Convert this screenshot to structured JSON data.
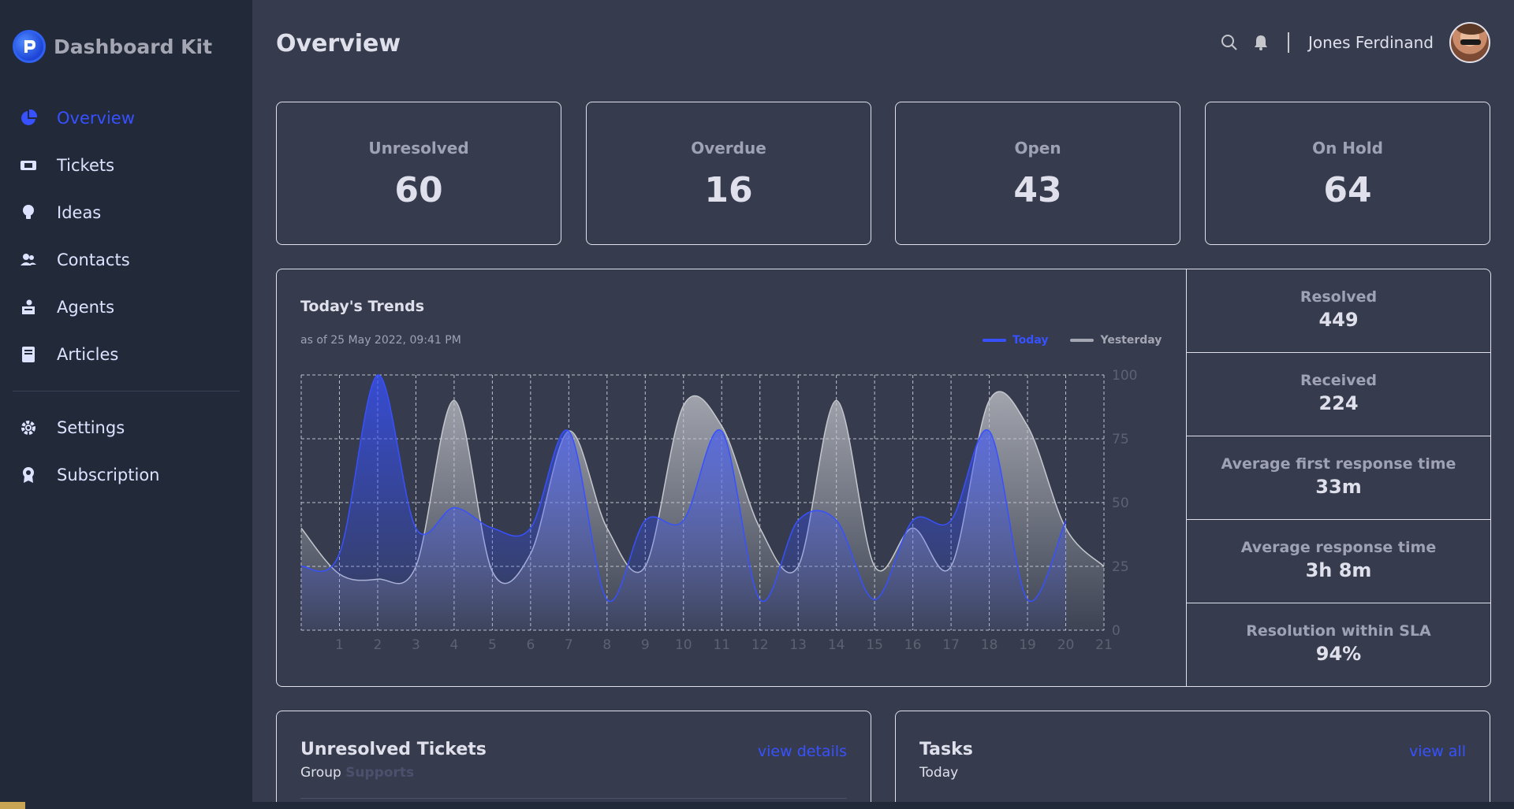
{
  "brand": {
    "name": "Dashboard Kit"
  },
  "nav": {
    "items": [
      {
        "label": "Overview",
        "icon": "pie-chart-icon",
        "active": true
      },
      {
        "label": "Tickets",
        "icon": "ticket-icon",
        "active": false
      },
      {
        "label": "Ideas",
        "icon": "lightbulb-icon",
        "active": false
      },
      {
        "label": "Contacts",
        "icon": "users-icon",
        "active": false
      },
      {
        "label": "Agents",
        "icon": "agent-icon",
        "active": false
      },
      {
        "label": "Articles",
        "icon": "book-icon",
        "active": false
      }
    ],
    "bottom_items": [
      {
        "label": "Settings",
        "icon": "gear-icon"
      },
      {
        "label": "Subscription",
        "icon": "award-icon"
      }
    ]
  },
  "header": {
    "title": "Overview",
    "user_name": "Jones Ferdinand",
    "icons": [
      "search-icon",
      "bell-icon"
    ]
  },
  "stats": [
    {
      "label": "Unresolved",
      "value": "60"
    },
    {
      "label": "Overdue",
      "value": "16"
    },
    {
      "label": "Open",
      "value": "43"
    },
    {
      "label": "On Hold",
      "value": "64"
    }
  ],
  "trends": {
    "title": "Today's Trends",
    "subtitle": "as of 25 May 2022, 09:41 PM",
    "legend": {
      "today": "Today",
      "yesterday": "Yesterday"
    },
    "colors": {
      "today": "#3751ff",
      "yesterday": "#a4a6b3"
    }
  },
  "chart_data": {
    "type": "area",
    "x": [
      0,
      1,
      2,
      3,
      4,
      5,
      6,
      7,
      8,
      9,
      10,
      11,
      12,
      13,
      14,
      15,
      16,
      17,
      18,
      19,
      20,
      21
    ],
    "x_tick_labels": [
      "1",
      "2",
      "3",
      "4",
      "5",
      "6",
      "7",
      "8",
      "9",
      "10",
      "11",
      "12",
      "13",
      "14",
      "15",
      "16",
      "17",
      "18",
      "19",
      "20",
      "21"
    ],
    "ylim": [
      0,
      100
    ],
    "y_ticks": [
      0,
      25,
      50,
      75,
      100
    ],
    "grid": true,
    "series": [
      {
        "name": "Today",
        "values": [
          25,
          30,
          100,
          40,
          48,
          40,
          40,
          78,
          12,
          43,
          43,
          78,
          12,
          43,
          43,
          12,
          43,
          43,
          78,
          12,
          43
        ]
      },
      {
        "name": "Yesterday",
        "values": [
          40,
          22,
          20,
          25,
          90,
          23,
          30,
          78,
          40,
          25,
          88,
          80,
          40,
          25,
          90,
          25,
          40,
          25,
          90,
          80,
          40,
          25
        ]
      }
    ]
  },
  "side_stats": [
    {
      "label": "Resolved",
      "value": "449"
    },
    {
      "label": "Received",
      "value": "224"
    },
    {
      "label": "Average first response time",
      "value": "33m"
    },
    {
      "label": "Average response time",
      "value": "3h 8m"
    },
    {
      "label": "Resolution within SLA",
      "value": "94%"
    }
  ],
  "unresolved_tickets": {
    "title": "Unresolved Tickets",
    "sub_prefix": "Group",
    "sub_group": "Supports",
    "link": "view details"
  },
  "tasks": {
    "title": "Tasks",
    "sub": "Today",
    "link": "view all"
  }
}
